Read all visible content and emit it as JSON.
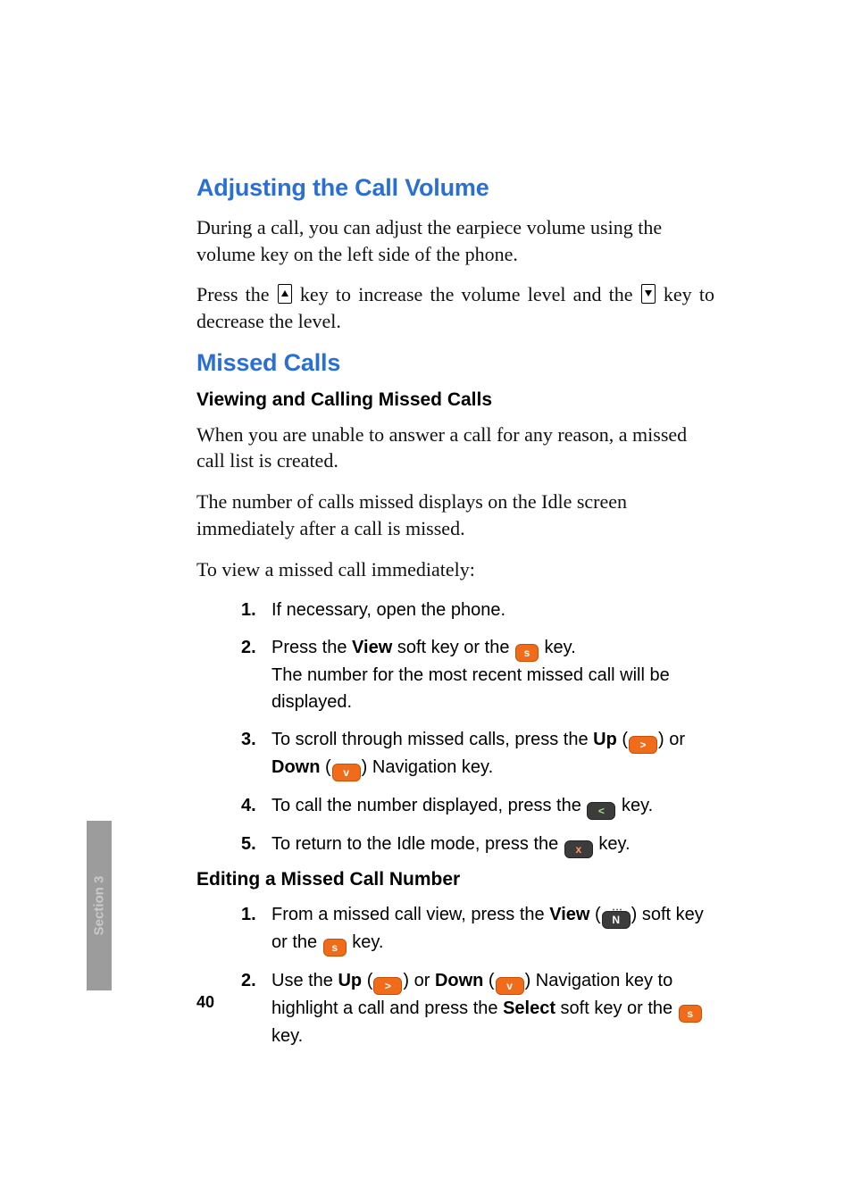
{
  "section_tab": "Section 3",
  "page_number": "40",
  "headings": {
    "h1a": "Adjusting the Call Volume",
    "h1b": "Missed Calls",
    "h2a": "Viewing and Calling Missed Calls",
    "h2b": "Editing a Missed Call Number"
  },
  "paras": {
    "p1": "During a call, you can adjust the earpiece volume using the volume key on the left side of the phone.",
    "p2a": "Press the ",
    "p2b": " key to increase the volume level and the ",
    "p2c": " key to decrease the level.",
    "p3": "When you are unable to answer a call for any reason, a missed call list is created.",
    "p4": "The number of calls missed displays on the Idle screen immediately after a call is missed.",
    "p5": "To view a missed call immediately:"
  },
  "listA": {
    "n1": "1.",
    "t1": "If necessary, open the phone.",
    "n2": "2.",
    "t2a": "Press the ",
    "t2b": "View",
    "t2c": " soft key or the ",
    "t2d": " key.",
    "t2e": "The number for the most recent missed call will be displayed.",
    "n3": "3.",
    "t3a": "To scroll through missed calls, press the ",
    "t3b": "Up",
    "t3c": " (",
    "t3d": ") or ",
    "t3e": "Down",
    "t3f": " (",
    "t3g": ") Navigation key.",
    "n4": "4.",
    "t4a": "To call the number displayed, press the ",
    "t4b": " key.",
    "n5": "5.",
    "t5a": "To return to the Idle mode, press the ",
    "t5b": " key."
  },
  "listB": {
    "n1": "1.",
    "t1a": "From a missed call view, press the ",
    "t1b": "View",
    "t1c": " (",
    "t1d": ") soft key or the ",
    "t1e": " key.",
    "n2": "2.",
    "t2a": "Use the ",
    "t2b": "Up",
    "t2c": " (",
    "t2d": ") or ",
    "t2e": "Down",
    "t2f": " (",
    "t2g": ") Navigation key to highlight a call and press the ",
    "t2h": "Select",
    "t2i": " soft key or the ",
    "t2j": " key."
  },
  "icons": {
    "vol_up": "▲",
    "vol_down": "▼",
    "ok": "s",
    "up_nav": ">",
    "down_nav": "v",
    "call": "<",
    "end": "x",
    "menu": "N"
  }
}
